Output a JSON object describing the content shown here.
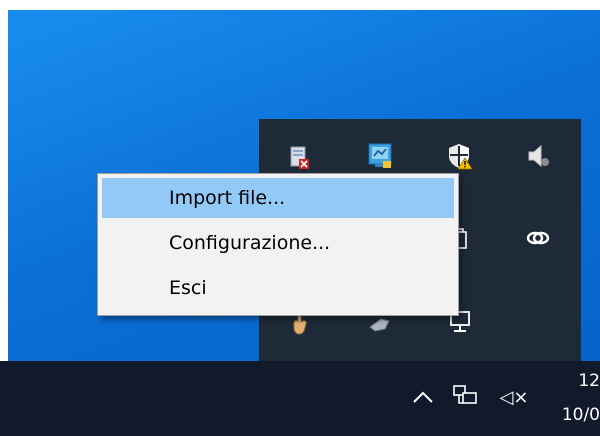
{
  "context_menu": {
    "items": [
      {
        "label": "Import file...",
        "highlighted": true
      },
      {
        "label": "Configurazione...",
        "highlighted": false
      },
      {
        "label": "Esci",
        "highlighted": false
      }
    ],
    "highlight_color": "#92c9f7"
  },
  "tray_flyout": {
    "icons": [
      "trash-doc-icon",
      "network-monitor-icon",
      "shield-warning-icon",
      "speaker-icon",
      "copy-icon",
      "link-icon",
      "hand-icon",
      "tool-icon",
      "display-icon"
    ]
  },
  "taskbar": {
    "show_hidden_icon": "chevron-up-icon",
    "network_icon": "network-icon",
    "volume_icon": "volume-muted-icon",
    "volume_text": "◁×",
    "clock_time": "12",
    "clock_date": "10/0"
  },
  "colors": {
    "desktop": "#0a6fd6",
    "taskbar": "#101a2a",
    "flyout": "#1f2a39"
  }
}
